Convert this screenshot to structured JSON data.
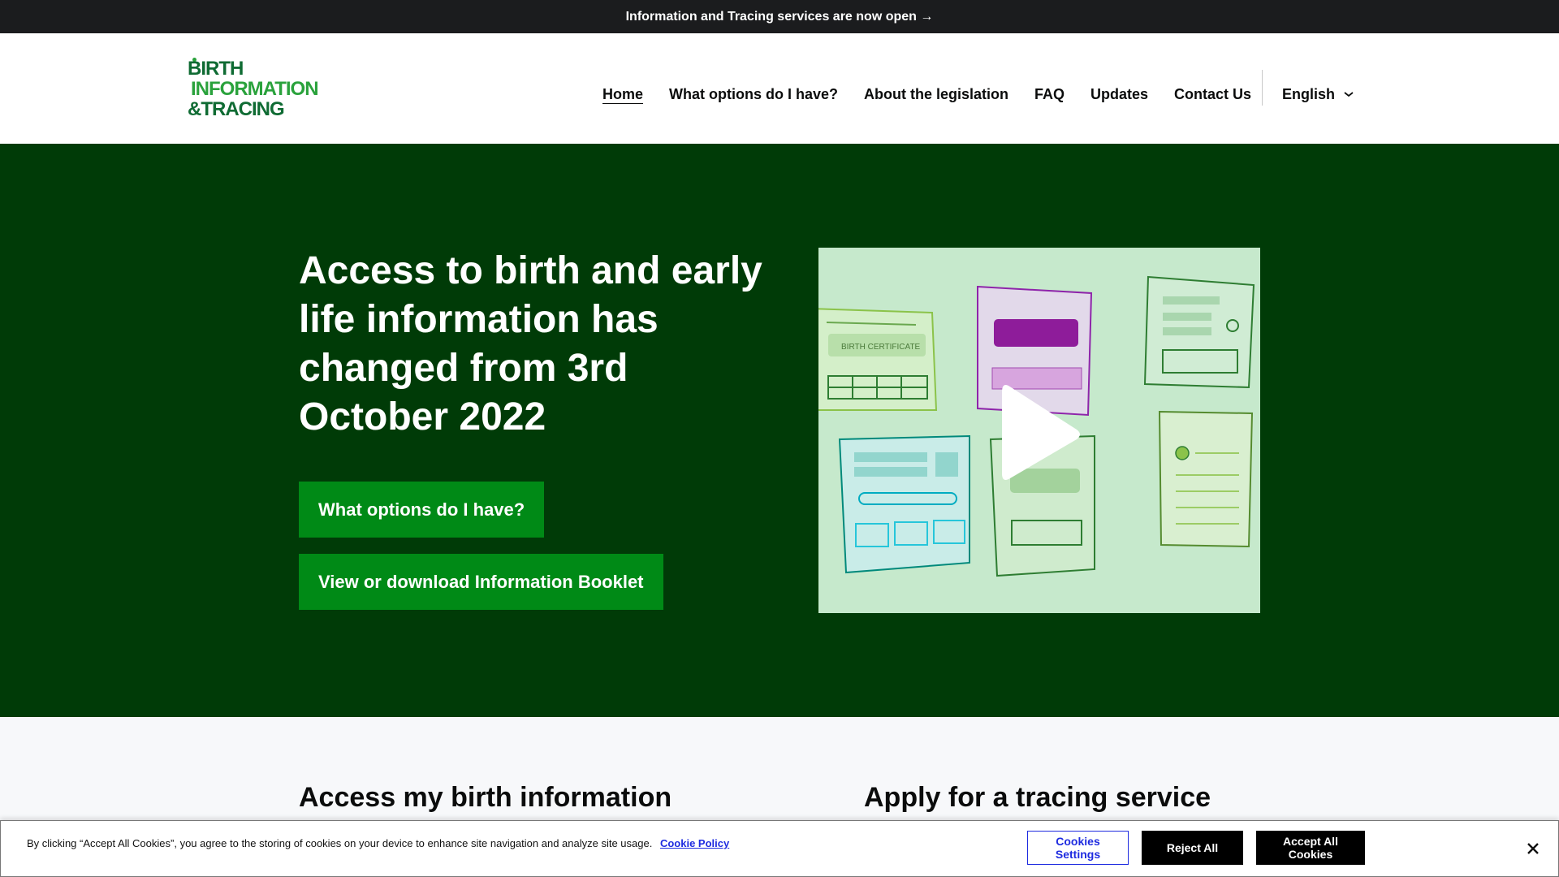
{
  "announcement": {
    "text": "Information and Tracing services are now open →"
  },
  "logo": {
    "line1": "BIRTH",
    "line2": "INFORMATION",
    "line3": "&TRACING"
  },
  "nav": {
    "items": [
      {
        "label": "Home",
        "active": true
      },
      {
        "label": "What options do I have?"
      },
      {
        "label": "About the legislation"
      },
      {
        "label": "FAQ"
      },
      {
        "label": "Updates"
      },
      {
        "label": "Contact Us"
      }
    ],
    "language": "English"
  },
  "hero": {
    "title": "Access to birth and early life information has changed from 3rd October 2022",
    "button1": "What options do I have?",
    "button2": "View or download Information Booklet",
    "video": {
      "certificate_label": "BIRTH CERTIFICATE"
    }
  },
  "sections": {
    "left_heading": "Access my birth information",
    "right_heading": "Apply for a tracing service"
  },
  "cookie": {
    "text": "By clicking “Accept All Cookies”, you agree to the storing of cookies on your device to enhance site navigation and analyze site usage.",
    "policy_link": "Cookie Policy",
    "settings": "Cookies Settings",
    "reject": "Reject All",
    "accept": "Accept All Cookies"
  },
  "colors": {
    "hero_bg": "#003b07",
    "button_green": "#008a16",
    "announcement_bg": "#1b1c1e",
    "video_bg": "#c6e9cc"
  }
}
